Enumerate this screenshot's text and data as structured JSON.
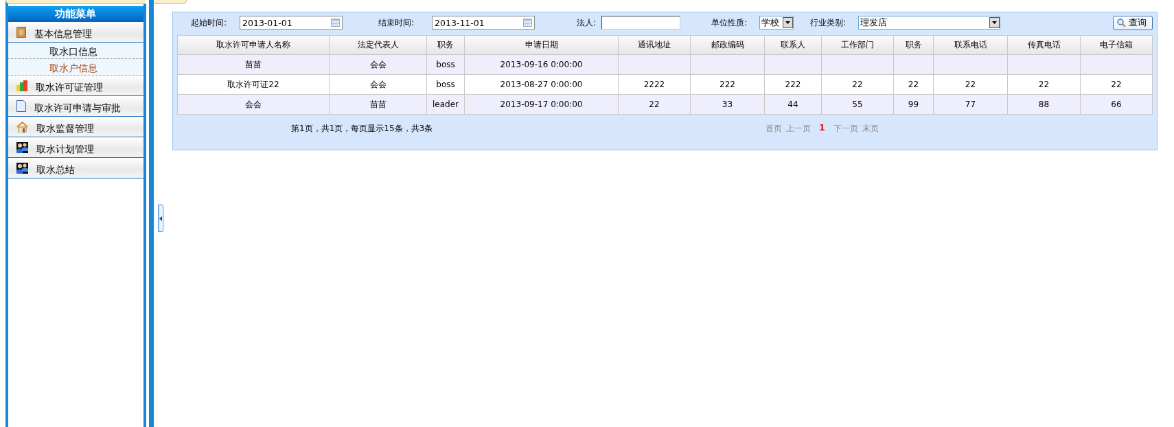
{
  "sidebar": {
    "title": "功能菜单",
    "items": [
      {
        "label": "基本信息管理",
        "children": [
          {
            "label": "取水口信息",
            "selected": false
          },
          {
            "label": "取水户信息",
            "selected": true
          }
        ]
      },
      {
        "label": "取水许可证管理"
      },
      {
        "label": "取水许可申请与审批"
      },
      {
        "label": "取水监督管理"
      },
      {
        "label": "取水计划管理"
      },
      {
        "label": "取水总结"
      }
    ]
  },
  "filters": [
    {
      "kind": "date",
      "label": "起始时间:",
      "value": "2013-01-01"
    },
    {
      "kind": "date",
      "label": "结束时间:",
      "value": "2013-11-01"
    },
    {
      "kind": "text",
      "label": "法人:"
    },
    {
      "kind": "select",
      "label": "单位性质:",
      "value": "学校"
    },
    {
      "kind": "select",
      "label": "行业类别:",
      "value": "理发店"
    }
  ],
  "search_button": {
    "label": "查询"
  },
  "table": {
    "columns": [
      "取水许可申请人名称",
      "法定代表人",
      "职务",
      "申请日期",
      "通讯地址",
      "邮政编码",
      "联系人",
      "工作部门",
      "职务",
      "联系电话",
      "传真电话",
      "电子信箱"
    ],
    "rows": [
      [
        "苗苗",
        "会会",
        "boss",
        "2013-09-16 0:00:00",
        null,
        null,
        null,
        null,
        null,
        null,
        null,
        null
      ],
      [
        "取水许可证22",
        "会会",
        "boss",
        "2013-08-27 0:00:00",
        "2222",
        "222",
        "222",
        "22",
        "22",
        "22",
        "22",
        "22"
      ],
      [
        "会会",
        "苗苗",
        "leader",
        "2013-09-17 0:00:00",
        "22",
        "33",
        "44",
        "55",
        "99",
        "77",
        "88",
        "66"
      ]
    ]
  },
  "pager": {
    "summary": "第1页，共1页，每页显示15条，共3条",
    "links": [
      {
        "kind": "nav",
        "label": "首页",
        "disabled": true
      },
      {
        "kind": "nav",
        "label": "上一页",
        "disabled": true
      },
      {
        "kind": "page",
        "label": "1",
        "selected": true
      },
      {
        "kind": "nav",
        "label": "下一页",
        "disabled": true
      },
      {
        "kind": "nav",
        "label": "末页",
        "disabled": true
      }
    ]
  }
}
